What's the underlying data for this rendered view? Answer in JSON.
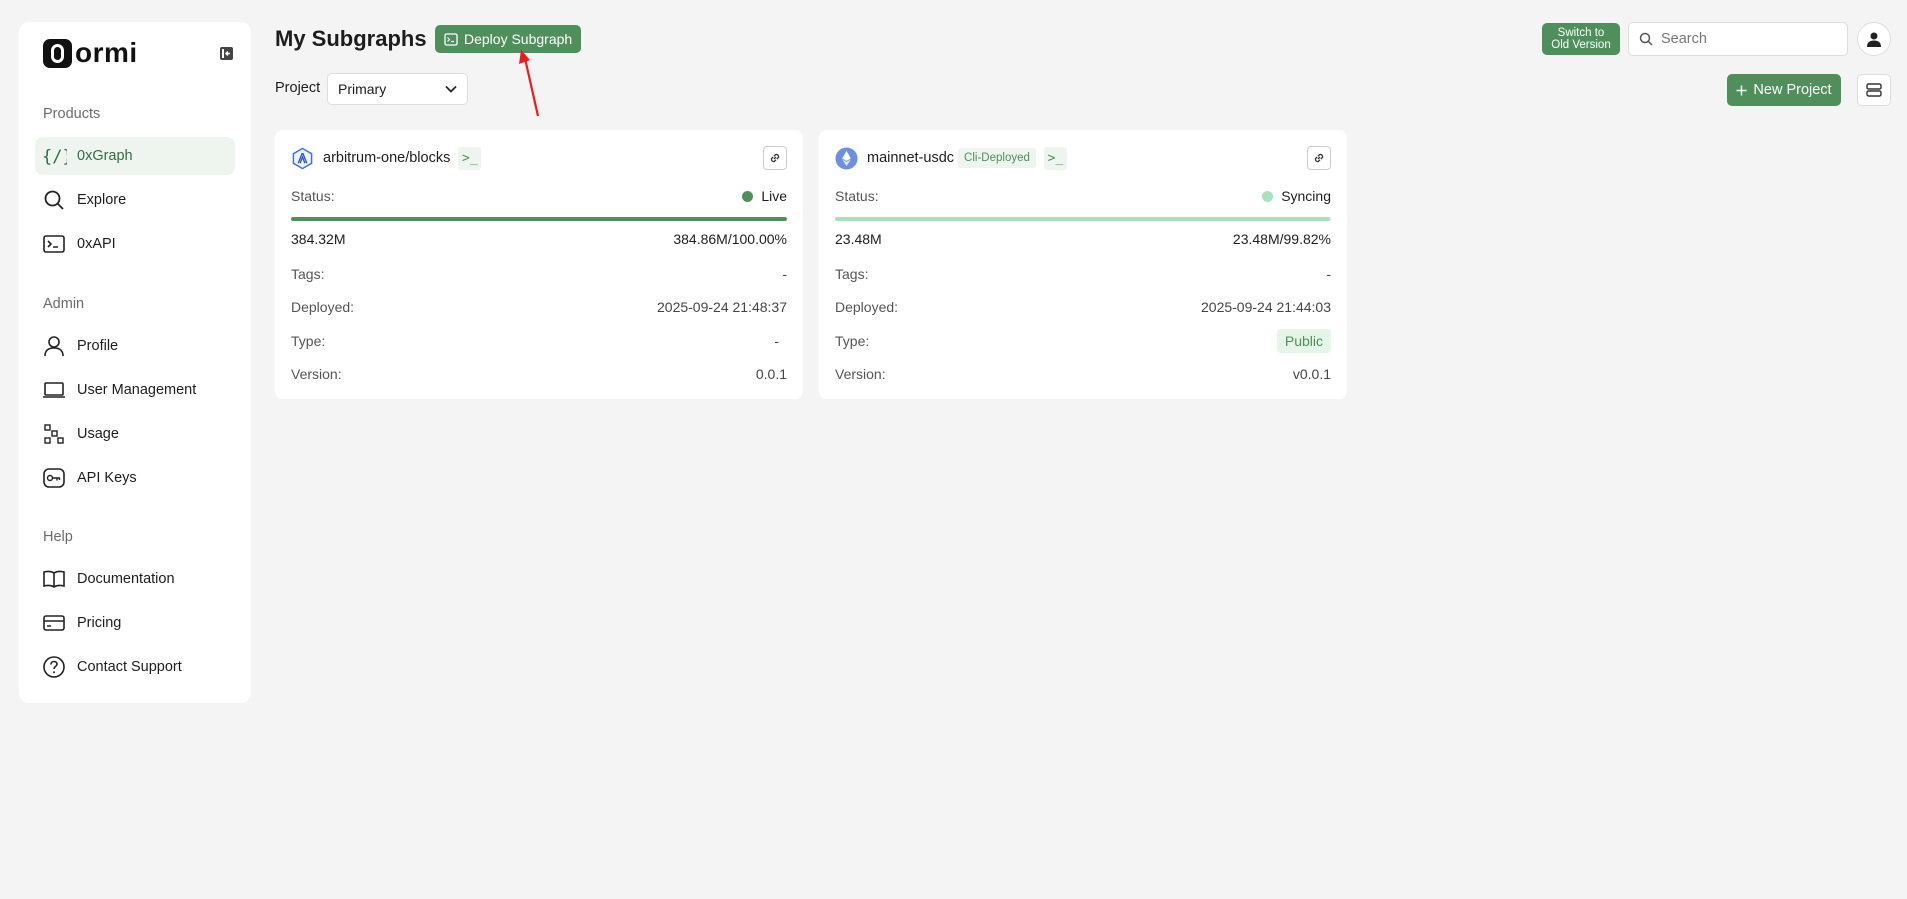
{
  "app": {
    "brand": "ormi"
  },
  "sidebar": {
    "sections": [
      {
        "title": "Products"
      },
      {
        "title": "Admin"
      },
      {
        "title": "Help"
      }
    ],
    "items": [
      {
        "label": "0xGraph",
        "icon": "code-braces-icon",
        "active": true
      },
      {
        "label": "Explore",
        "icon": "search-icon"
      },
      {
        "label": "0xAPI",
        "icon": "terminal-icon"
      },
      {
        "label": "Profile",
        "icon": "user-icon"
      },
      {
        "label": "User Management",
        "icon": "laptop-icon"
      },
      {
        "label": "Usage",
        "icon": "usage-icon"
      },
      {
        "label": "API Keys",
        "icon": "key-icon"
      },
      {
        "label": "Documentation",
        "icon": "book-icon"
      },
      {
        "label": "Pricing",
        "icon": "credit-card-icon"
      },
      {
        "label": "Contact Support",
        "icon": "help-circle-icon"
      }
    ]
  },
  "header": {
    "title": "My Subgraphs",
    "deploy_label": "Deploy Subgraph",
    "switch_label_line1": "Switch to",
    "switch_label_line2": "Old Version",
    "search_placeholder": "Search"
  },
  "toolbar": {
    "project_label": "Project",
    "project_value": "Primary",
    "new_project_label": "New Project"
  },
  "colors": {
    "accent": "#4e8f5b",
    "live": "#4e8f5b",
    "syncing": "#a8e0c2"
  },
  "cards": [
    {
      "name": "arbitrum-one/blocks",
      "status_label": "Status:",
      "status": "Live",
      "progress": 1.0,
      "current_block": "384.32M",
      "total_block": "384.86M/100.00%",
      "tags_label": "Tags:",
      "tags": "-",
      "deployed_label": "Deployed:",
      "deployed": "2025-09-24 21:48:37",
      "type_label": "Type:",
      "type": "-",
      "version_label": "Version:",
      "version": "0.0.1"
    },
    {
      "name": "mainnet-usdc",
      "badge": "Cli-Deployed",
      "status_label": "Status:",
      "status": "Syncing",
      "progress": 0.9982,
      "current_block": "23.48M",
      "total_block": "23.48M/99.82%",
      "tags_label": "Tags:",
      "tags": "-",
      "deployed_label": "Deployed:",
      "deployed": "2025-09-24 21:44:03",
      "type_label": "Type:",
      "type": "Public",
      "version_label": "Version:",
      "version": "v0.0.1"
    }
  ]
}
